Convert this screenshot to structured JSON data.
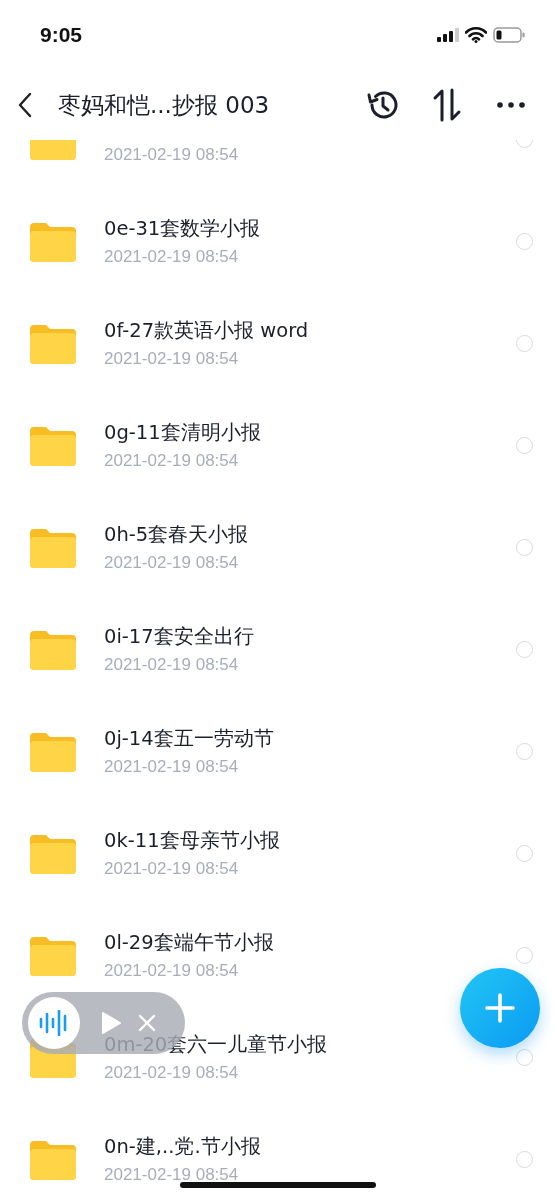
{
  "status_bar": {
    "time": "9:05"
  },
  "nav": {
    "title": "枣妈和恺...抄报 003"
  },
  "items": [
    {
      "date": "2021-02-19 08:54",
      "selected": false
    },
    {
      "name": "0e-31套数学小报",
      "date": "2021-02-19 08:54",
      "selected": false
    },
    {
      "name": "0f-27款英语小报 word",
      "date": "2021-02-19 08:54",
      "selected": false
    },
    {
      "name": "0g-11套清明小报",
      "date": "2021-02-19 08:54",
      "selected": false
    },
    {
      "name": "0h-5套春天小报",
      "date": "2021-02-19 08:54",
      "selected": false
    },
    {
      "name": "0i-17套安全出行",
      "date": "2021-02-19 08:54",
      "selected": false
    },
    {
      "name": "0j-14套五一劳动节",
      "date": "2021-02-19 08:54",
      "selected": false
    },
    {
      "name": "0k-11套母亲节小报",
      "date": "2021-02-19 08:54",
      "selected": false
    },
    {
      "name": "0l-29套端午节小报",
      "date": "2021-02-19 08:54",
      "selected": false
    },
    {
      "name": "0m-20套六一儿童节小报",
      "date": "2021-02-19 08:54",
      "selected": false
    },
    {
      "name": "0n-建,..党.节小报",
      "date": "2021-02-19 08:54",
      "selected": false
    }
  ]
}
